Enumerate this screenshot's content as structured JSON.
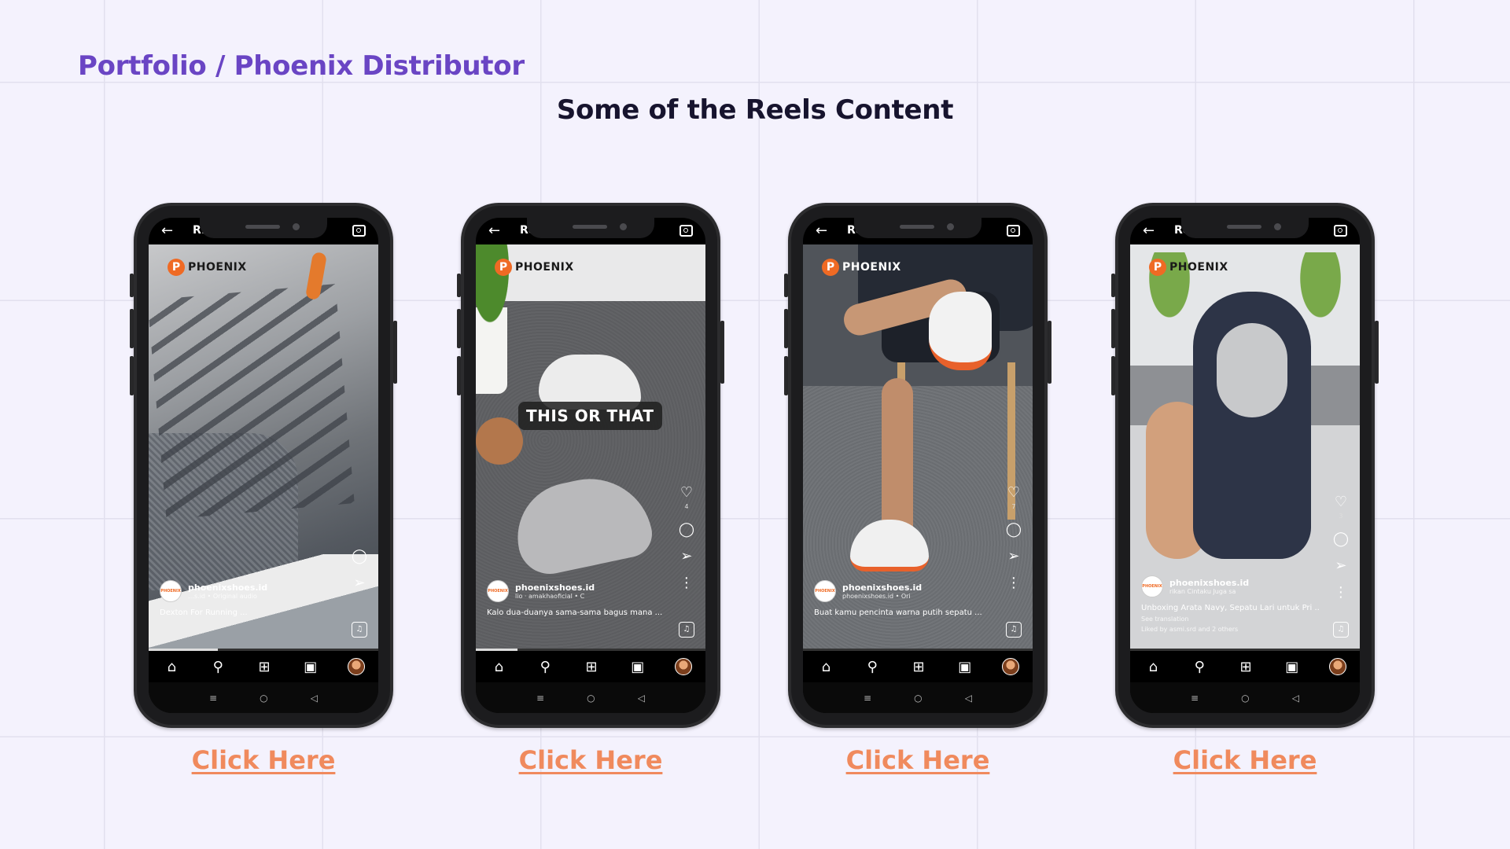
{
  "page": {
    "breadcrumb": "Portfolio / Phoenix Distributor",
    "subtitle": "Some of the Reels Content",
    "accent_color": "#6a45c4",
    "link_color": "#f08a5d"
  },
  "phones": [
    {
      "top_title": "R...",
      "logo": "PHOENIX",
      "username": "phoenixshoes.id",
      "audio": "…s.id • Original audio",
      "caption": "Dexton For Running ...",
      "likes": "",
      "progress": 0.3,
      "link": "Click Here"
    },
    {
      "top_title": "Reels",
      "logo": "PHOENIX",
      "overlay_text": "THIS OR THAT",
      "username": "phoenixshoes.id",
      "audio": "lio · amakhaoficial • C",
      "caption": "Kalo dua-duanya sama-sama bagus mana ...",
      "likes": "4",
      "progress": 0.18,
      "link": "Click Here"
    },
    {
      "top_title": "Reels",
      "logo": "PHOENIX",
      "username": "phoenixshoes.id",
      "audio": "phoenixshoes.id • Ori",
      "caption": "Buat kamu pencinta warna putih sepatu ...",
      "likes": "7",
      "progress": 0,
      "link": "Click Here"
    },
    {
      "top_title": "Re...",
      "logo": "PHOENIX",
      "username": "phoenixshoes.id",
      "audio": "rikan Cintaku Juga sa",
      "caption": "Unboxing Arata Navy, Sepatu Lari untuk Pri ...",
      "see_translation": "See translation",
      "liked_by": "Liked by asmi.srd and 2 others",
      "likes": "3",
      "progress": 0,
      "link": "Click Here"
    }
  ],
  "icons": {
    "back": "←",
    "heart": "♡",
    "comment": "◯",
    "share": "➢",
    "more": "⋮",
    "music": "♫",
    "home": "⌂",
    "search": "⚲",
    "add": "⊞",
    "reels": "▣",
    "sys_menu": "≡",
    "sys_home": "○",
    "sys_back": "◁"
  }
}
